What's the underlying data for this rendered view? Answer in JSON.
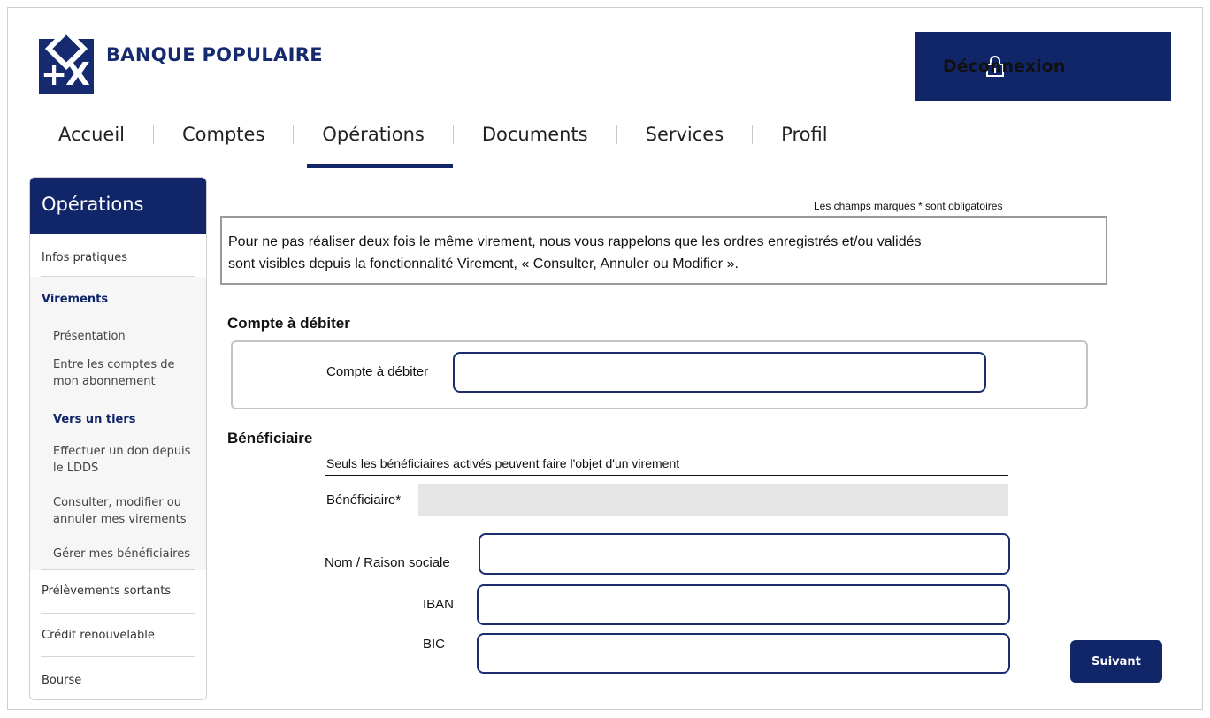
{
  "header": {
    "brand_name": "BANQUE POPULAIRE",
    "logo_text": "+X",
    "logout_label": "Déconnexion"
  },
  "nav": {
    "items": [
      "Accueil",
      "Comptes",
      "Opérations",
      "Documents",
      "Services",
      "Profil"
    ],
    "active": "Opérations"
  },
  "sidebar": {
    "title": "Opérations",
    "infos_pratiques": "Infos pratiques",
    "virements_title": "Virements",
    "virements_items": {
      "presentation": "Présentation",
      "entre_l1": "Entre les comptes de",
      "entre_l2": "mon abonnement",
      "tiers": "Vers un tiers",
      "don_l1": "Effectuer un don depuis",
      "don_l2": "le LDDS",
      "consulter_l1": "Consulter, modifier ou",
      "consulter_l2": "annuler mes virements",
      "gerer": "Gérer mes bénéficiaires"
    },
    "prelevements": "Prélèvements sortants",
    "credit": "Crédit renouvelable",
    "bourse": "Bourse"
  },
  "main": {
    "required_note": "Les champs marqués * sont obligatoires",
    "info_line1": "Pour ne pas réaliser deux fois le même virement, nous vous rappelons que les ordres enregistrés et/ou validés",
    "info_line2": "sont visibles depuis la fonctionnalité Virement, « Consulter, Annuler ou Modifier ».",
    "debit_section_title": "Compte à débiter",
    "debit_label": "Compte à débiter",
    "debit_value": "",
    "benef_section_title": "Bénéficiaire",
    "benef_note": "Seuls les bénéficiaires activés peuvent faire l'objet d'un virement",
    "benef_label": "Bénéficiaire*",
    "nom_label": "Nom / Raison sociale",
    "iban_label": "IBAN",
    "bic_label": "BIC",
    "next_button": "Suivant"
  },
  "colors": {
    "brand_navy": "#102669",
    "border_grey": "#c4c4c4"
  }
}
